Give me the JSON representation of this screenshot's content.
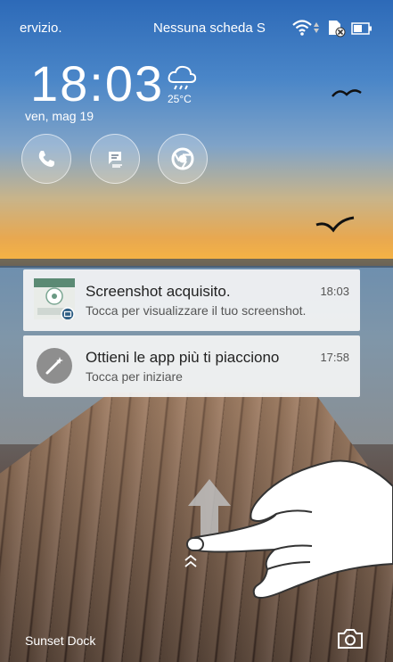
{
  "status_bar": {
    "carrier_left": "ervizio.",
    "carrier_right": "Nessuna scheda S",
    "icons": [
      "wifi-icon",
      "sim-missing-icon",
      "battery-icon"
    ]
  },
  "clock": {
    "time": "18:03",
    "date": "ven, mag 19",
    "weather_icon": "cloud-rain-icon",
    "temperature": "25°C"
  },
  "shortcuts": [
    {
      "name": "phone-shortcut",
      "icon": "phone-icon"
    },
    {
      "name": "messages-shortcut",
      "icon": "messages-icon"
    },
    {
      "name": "chrome-shortcut",
      "icon": "chrome-icon"
    }
  ],
  "notifications": [
    {
      "title": "Screenshot acquisito.",
      "time": "18:03",
      "text": "Tocca per visualizzare il tuo screenshot.",
      "icon": "screenshot-thumbnail"
    },
    {
      "title": "Ottieni le app più ti piacciono",
      "time": "17:58",
      "text": "Tocca per iniziare",
      "icon": "magic-wand-icon"
    }
  ],
  "unlock_hint": {
    "icon": "swipe-up-arrow-icon"
  },
  "wallpaper": {
    "name": "Sunset Dock"
  },
  "camera": {
    "icon": "camera-icon"
  }
}
